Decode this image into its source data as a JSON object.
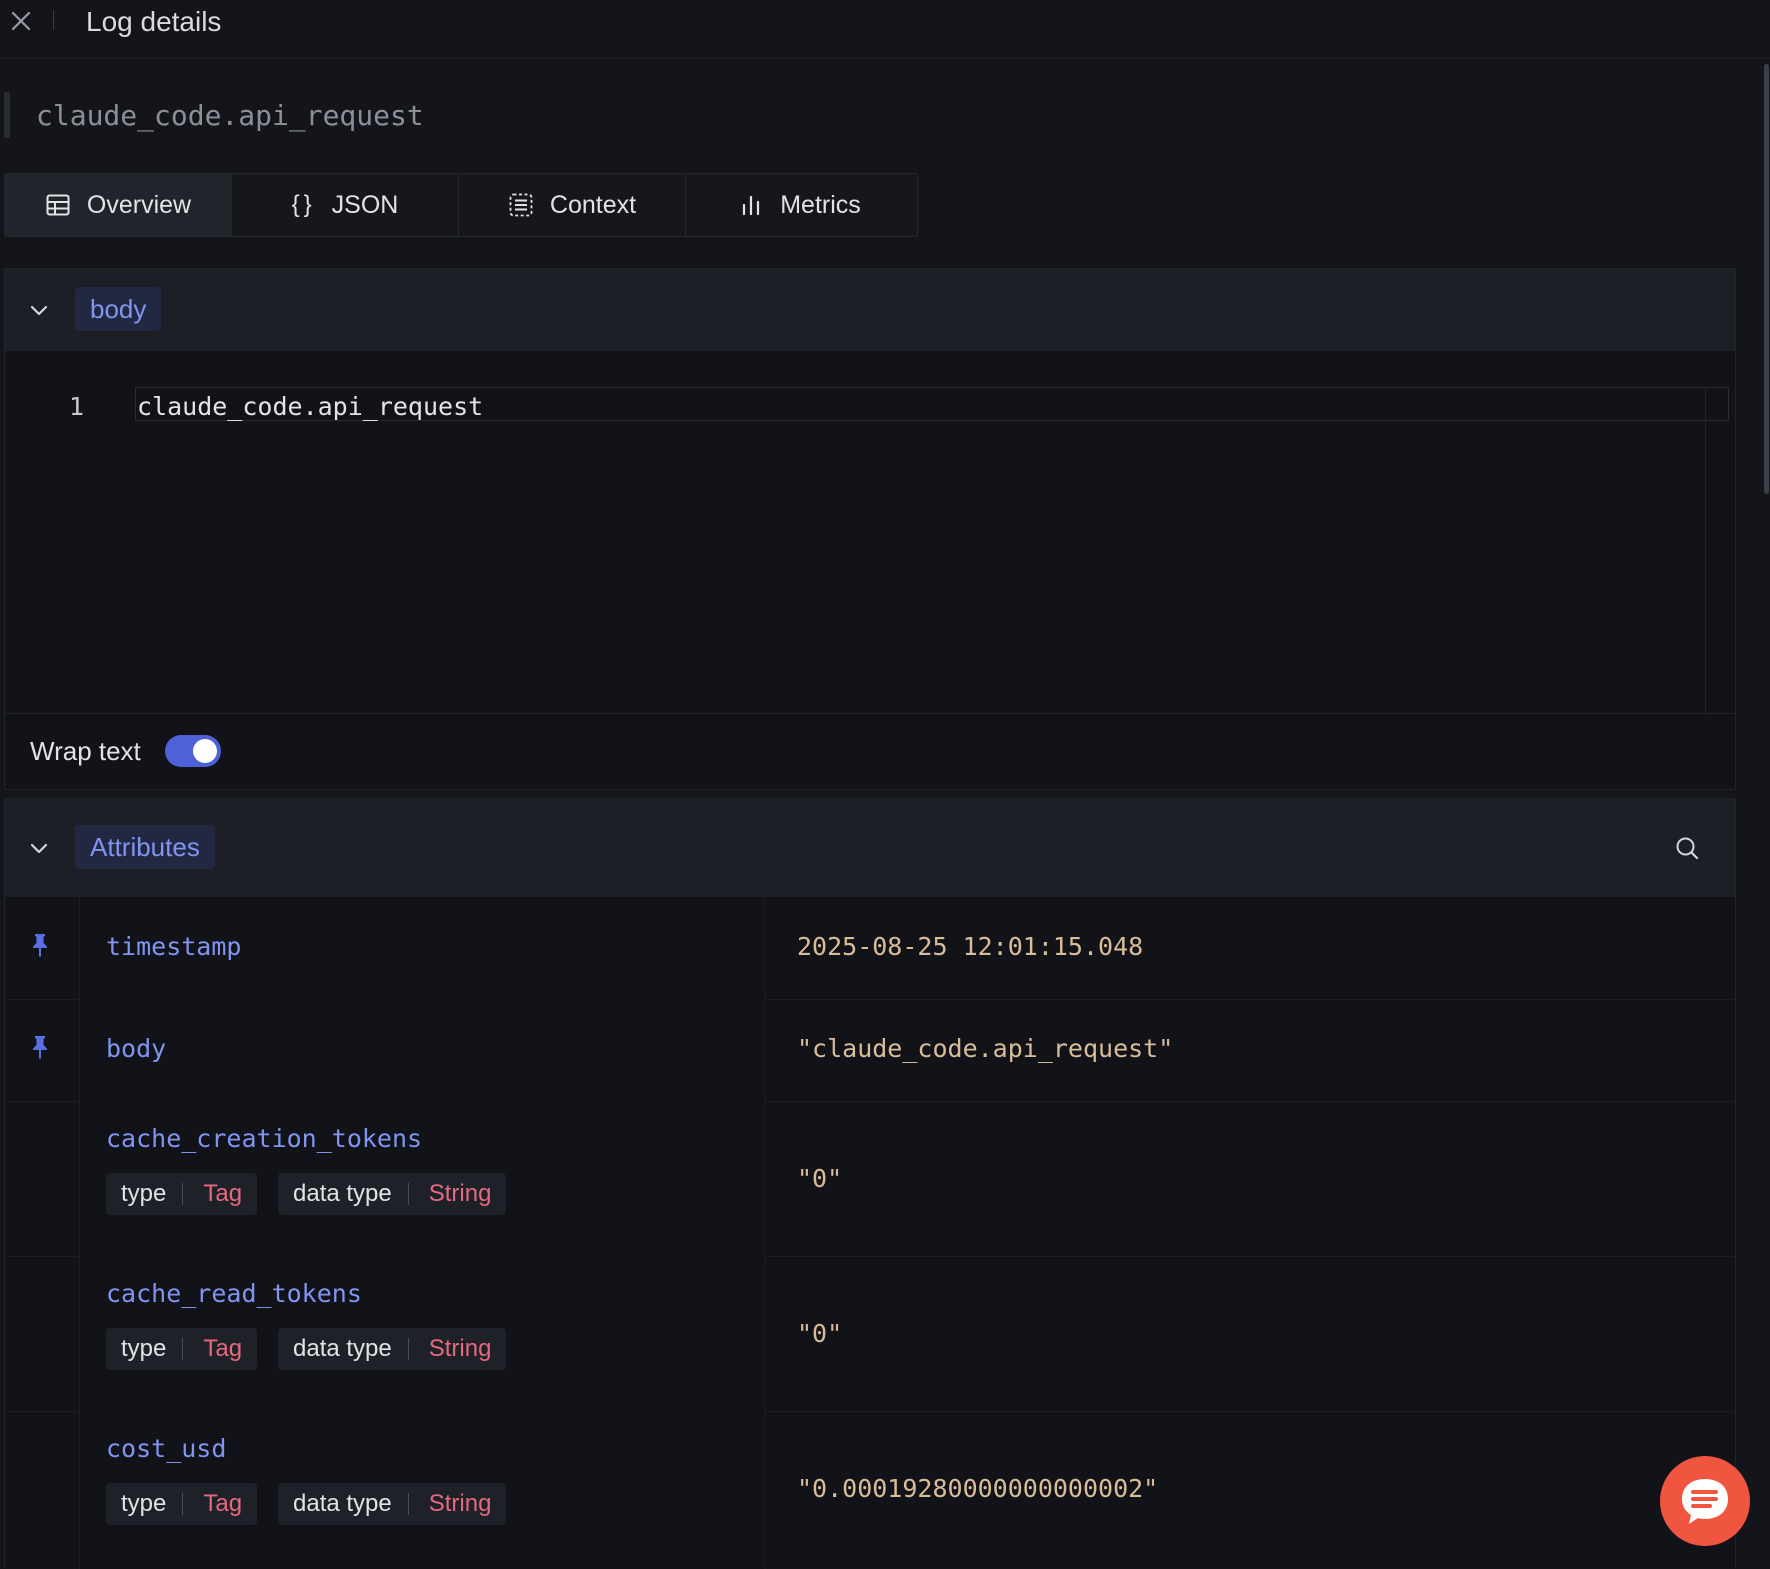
{
  "header": {
    "title": "Log details"
  },
  "log_name": "claude_code.api_request",
  "tabs": [
    {
      "label": "Overview",
      "icon": "table-icon",
      "active": true
    },
    {
      "label": "JSON",
      "icon": "braces-icon",
      "active": false
    },
    {
      "label": "Context",
      "icon": "context-icon",
      "active": false
    },
    {
      "label": "Metrics",
      "icon": "bar-chart-icon",
      "active": false
    }
  ],
  "body_section": {
    "title": "body",
    "line_number": "1",
    "code": "claude_code.api_request",
    "wrap_text_label": "Wrap text",
    "wrap_text_enabled": true
  },
  "attributes_section": {
    "title": "Attributes",
    "rows": [
      {
        "key": "timestamp",
        "value": "2025-08-25 12:01:15.048",
        "pinned": true
      },
      {
        "key": "body",
        "value": "\"claude_code.api_request\"",
        "pinned": true
      },
      {
        "key": "cache_creation_tokens",
        "value": "\"0\"",
        "pinned": false,
        "type_label": "type",
        "type_value": "Tag",
        "data_type_label": "data type",
        "data_type_value": "String"
      },
      {
        "key": "cache_read_tokens",
        "value": "\"0\"",
        "pinned": false,
        "type_label": "type",
        "type_value": "Tag",
        "data_type_label": "data type",
        "data_type_value": "String"
      },
      {
        "key": "cost_usd",
        "value": "\"0.00019280000000000002\"",
        "pinned": false,
        "type_label": "type",
        "type_value": "Tag",
        "data_type_label": "data type",
        "data_type_value": "String"
      }
    ]
  },
  "colors": {
    "background": "#14151b",
    "accent": "#4e61d6",
    "key_text": "#7f95f0",
    "value_text": "#d9bd98",
    "tag_value": "#e5697e",
    "fab": "#f0563f"
  }
}
